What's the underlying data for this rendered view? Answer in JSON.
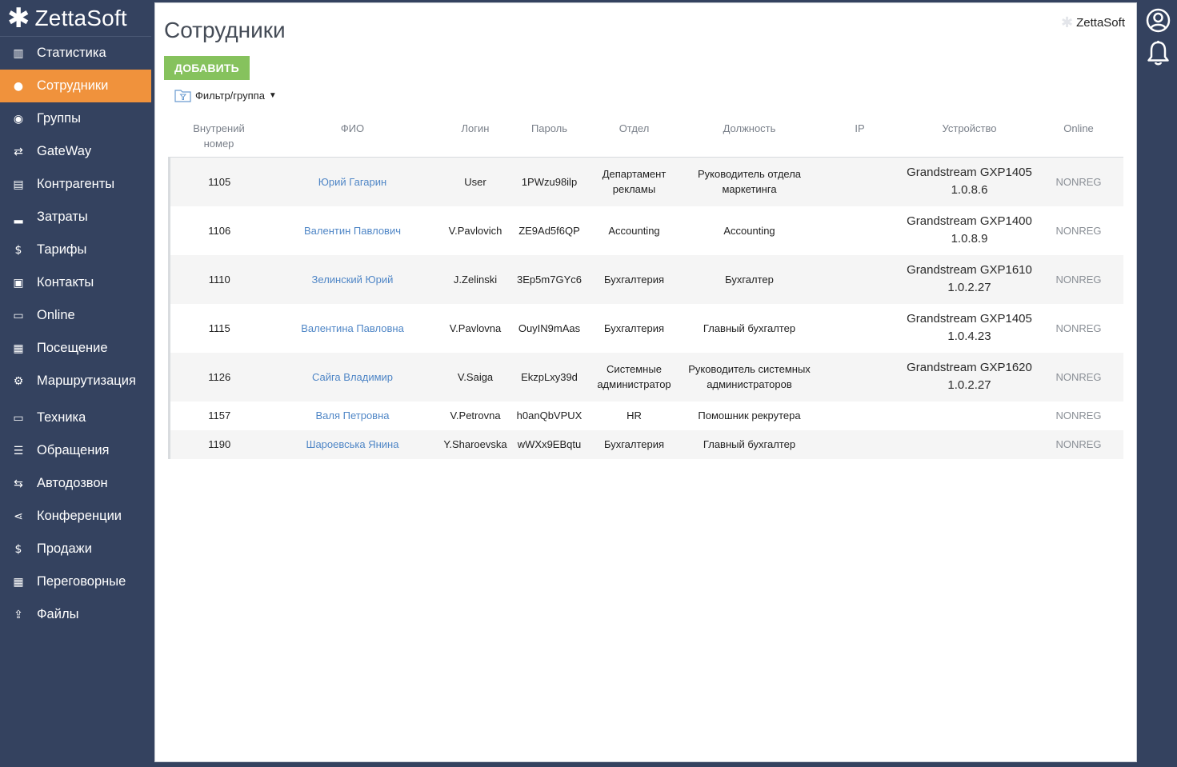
{
  "brand": {
    "name": "ZettaSoft"
  },
  "sidebar": {
    "items": [
      {
        "label": "Статистика",
        "icon": "bar-chart-icon",
        "glyph": "▥",
        "active": false
      },
      {
        "label": "Сотрудники",
        "icon": "user-icon",
        "glyph": "●",
        "active": true
      },
      {
        "label": "Группы",
        "icon": "users-icon",
        "glyph": "◉",
        "active": false
      },
      {
        "label": "GateWay",
        "icon": "shuffle-icon",
        "glyph": "⇄",
        "active": false
      },
      {
        "label": "Контрагенты",
        "icon": "building-icon",
        "glyph": "▤",
        "active": false
      },
      {
        "label": "Затраты",
        "icon": "signal-icon",
        "glyph": "▂",
        "active": false
      },
      {
        "label": "Тарифы",
        "icon": "dollar-icon",
        "glyph": "$",
        "active": false
      },
      {
        "label": "Контакты",
        "icon": "address-card-icon",
        "glyph": "▣",
        "active": false
      },
      {
        "label": "Online",
        "icon": "inbox-icon",
        "glyph": "▭",
        "active": false
      },
      {
        "label": "Посещение",
        "icon": "contact-book-icon",
        "glyph": "▦",
        "active": false
      },
      {
        "label": "Маршрутизация",
        "icon": "cogs-icon",
        "glyph": "⚙",
        "active": false
      },
      {
        "label": "Техника",
        "icon": "desktop-icon",
        "glyph": "▭",
        "active": false
      },
      {
        "label": "Обращения",
        "icon": "list-icon",
        "glyph": "☰",
        "active": false
      },
      {
        "label": "Автодозвон",
        "icon": "exchange-icon",
        "glyph": "⇆",
        "active": false
      },
      {
        "label": "Конференции",
        "icon": "share-icon",
        "glyph": "⋖",
        "active": false
      },
      {
        "label": "Продажи",
        "icon": "dollar-icon",
        "glyph": "$",
        "active": false
      },
      {
        "label": "Переговорные",
        "icon": "calendar-icon",
        "glyph": "▦",
        "active": false
      },
      {
        "label": "Файлы",
        "icon": "upload-icon",
        "glyph": "⇪",
        "active": false
      }
    ]
  },
  "main": {
    "title": "Сотрудники",
    "corner_brand": "ZettaSoft",
    "add_button": "ДОБАВИТЬ",
    "filter_label": "Фильтр/группа"
  },
  "table": {
    "headers": [
      "Внутрений номер",
      "ФИО",
      "Логин",
      "Пароль",
      "Отдел",
      "Должность",
      "IP",
      "Устройство",
      "Online"
    ],
    "rows": [
      {
        "ext": "1105",
        "fio": "Юрий Гагарин",
        "login": "User",
        "password": "1PWzu98ilp",
        "dept": "Департамент рекламы",
        "position": "Руководитель отдела маркетинга",
        "ip": "",
        "device": "Grandstream GXP1405 1.0.8.6",
        "online": "NONREG"
      },
      {
        "ext": "1106",
        "fio": "Валентин Павлович",
        "login": "V.Pavlovich",
        "password": "ZE9Ad5f6QP",
        "dept": "Accounting",
        "position": "Accounting",
        "ip": "",
        "device": "Grandstream GXP1400 1.0.8.9",
        "online": "NONREG"
      },
      {
        "ext": "1110",
        "fio": "Зелинский Юрий",
        "login": "J.Zelinski",
        "password": "3Ep5m7GYc6",
        "dept": "Бухгалтерия",
        "position": "Бухгалтер",
        "ip": "",
        "device": "Grandstream GXP1610 1.0.2.27",
        "online": "NONREG"
      },
      {
        "ext": "1115",
        "fio": "Валентина Павловна",
        "login": "V.Pavlovna",
        "password": "OuyIN9mAas",
        "dept": "Бухгалтерия",
        "position": "Главный бухгалтер",
        "ip": "",
        "device": "Grandstream GXP1405 1.0.4.23",
        "online": "NONREG"
      },
      {
        "ext": "1126",
        "fio": "Сайга Владимир",
        "login": "V.Saiga",
        "password": "EkzpLxy39d",
        "dept": "Системные администратор",
        "position": "Руководитель системных администраторов",
        "ip": "",
        "device": "Grandstream GXP1620 1.0.2.27",
        "online": "NONREG"
      },
      {
        "ext": "1157",
        "fio": "Валя Петровна",
        "login": "V.Petrovna",
        "password": "h0anQbVPUX",
        "dept": "HR",
        "position": "Помошник рекрутера",
        "ip": "",
        "device": "",
        "online": "NONREG"
      },
      {
        "ext": "1190",
        "fio": "Шароевська Янина",
        "login": "Y.Sharoevska",
        "password": "wWXx9EBqtu",
        "dept": "Бухгалтерия",
        "position": "Главный бухгалтер",
        "ip": "",
        "device": "",
        "online": "NONREG"
      }
    ]
  },
  "colors": {
    "sidebar": "#34425f",
    "active": "#f0923c",
    "add_button": "#86c25d",
    "link": "#4f86c6"
  }
}
